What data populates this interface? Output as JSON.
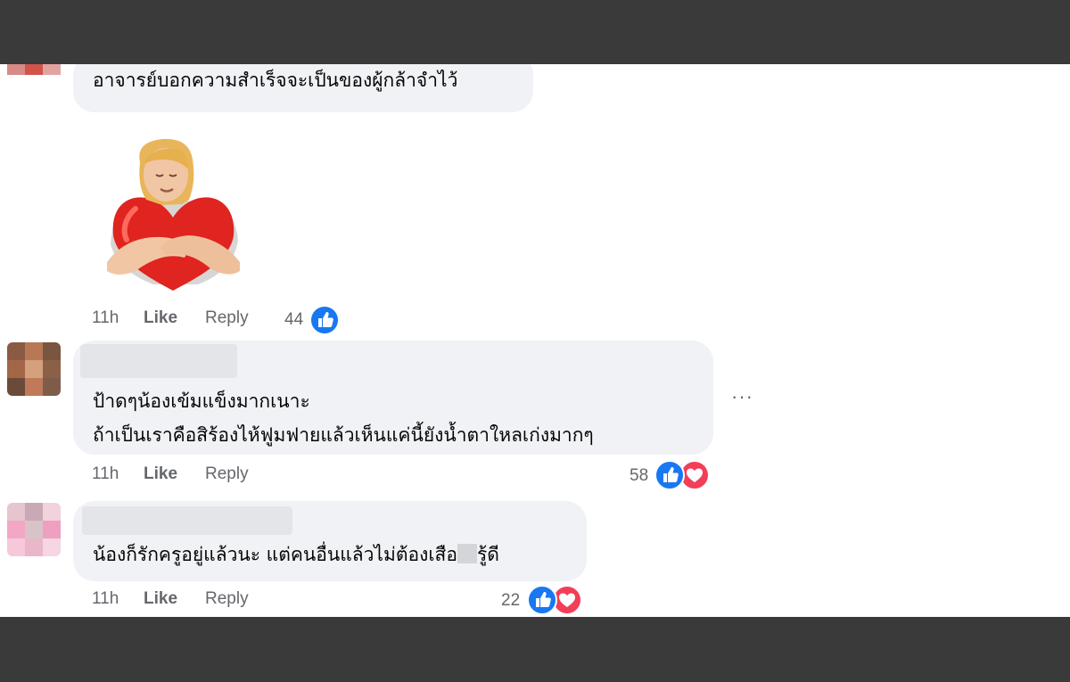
{
  "comments": [
    {
      "text_lines": [
        "อาจารย์บอกความสำเร็จจะเป็นของผู้กล้าจำไว้"
      ],
      "time": "11h",
      "like_label": "Like",
      "reply_label": "Reply",
      "reaction_count": "44",
      "reactions": [
        "like"
      ],
      "sticker": "hugging-heart-sticker"
    },
    {
      "text_lines": [
        "ป้าดๆน้องเข้มแข็งมากเนาะ",
        "ถ้าเป็นเราคือสิร้องไห้ฟูมฟายแล้วเห็นแค่นี้ยังน้ำตาใหลเก่งมากๆ"
      ],
      "time": "11h",
      "like_label": "Like",
      "reply_label": "Reply",
      "reaction_count": "58",
      "reactions": [
        "like",
        "love"
      ],
      "more_label": "···"
    },
    {
      "text_before": "น้องก็รักครูอยู่แล้วนะ แต่คนอื่นแล้วไม่ต้องเสือ",
      "text_after": "รู้ดี",
      "time": "11h",
      "like_label": "Like",
      "reply_label": "Reply",
      "reaction_count": "22",
      "reactions": [
        "like",
        "love"
      ]
    }
  ],
  "colors": {
    "bubble": "#f0f2f5",
    "like": "#1877f2",
    "love": "#f33e58",
    "meta": "#65676b",
    "frame": "#3a3a3a"
  },
  "icons": [
    "thumbs-up-icon",
    "heart-icon",
    "more-icon"
  ]
}
